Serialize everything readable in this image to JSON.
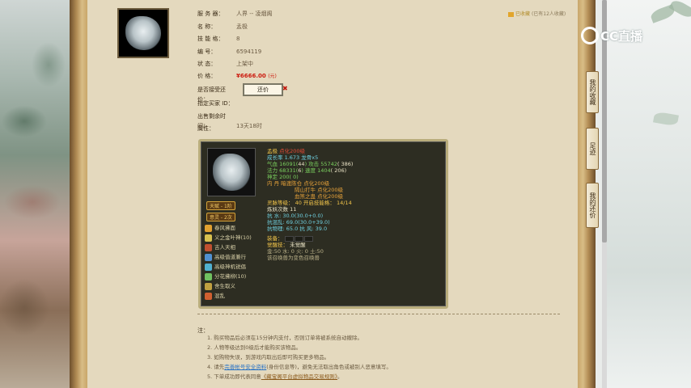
{
  "watermark": {
    "text": "CC直播"
  },
  "favorite": {
    "link": "已收藏",
    "count": "(已有12人收藏)"
  },
  "side_tabs": [
    "我的收藏",
    "足迹",
    "我的还价"
  ],
  "info_rows": [
    {
      "label": "服  务  器：",
      "value": "人界 -- 凌烟阁"
    },
    {
      "label": "名        称：",
      "value": "孟极"
    },
    {
      "label": "技  能  格：",
      "value": "8"
    },
    {
      "label": "编        号：",
      "value": "6594119"
    },
    {
      "label": "状        态：",
      "value": "上架中"
    },
    {
      "label": "价        格：",
      "value": "¥6666.00",
      "unit": "(元)"
    },
    {
      "label": "是否接受还价：",
      "value": ""
    },
    {
      "label": "指定买家 ID：",
      "value": ""
    },
    {
      "label": "出售剩余时间：",
      "value": "13天18时"
    },
    {
      "label": "属性：",
      "value": ""
    }
  ],
  "bargain_button": "还价",
  "bargain_reject": "✖",
  "card": {
    "pill_tianjue": "天赋 - 1阶",
    "pill_yili": "意灵 - 2次",
    "skills": [
      {
        "name": "春风拂面",
        "color": "#e0a030"
      },
      {
        "name": "义之金叶神(10)",
        "color": "#d7c050"
      },
      {
        "name": "吉人天相",
        "color": "#c05030"
      },
      {
        "name": "高级值道兼行",
        "color": "#5090d0"
      },
      {
        "name": "高级神机锐倡",
        "color": "#50b0d0"
      },
      {
        "name": "分花拂柳(10)",
        "color": "#70c060"
      },
      {
        "name": "舍生取义",
        "color": "#c0a040"
      },
      {
        "name": "混乱",
        "color": "#d06030"
      }
    ],
    "stats": {
      "name": "孟极",
      "name_tag": "点化200级",
      "growth": "成长率 1.673 龙骨x5",
      "hp": "气血 16091(",
      "hp_b": "44",
      "hp_c": ") 攻击 ",
      "atk": "55742",
      "atk_b": "( 386)",
      "mp": "法力 68331(",
      "mp_b": "6",
      "mp_c": ") 速度 ",
      "spd": "1404",
      "spd_b": "( 206)",
      "def": "神定 200( 0)",
      "inner_1": "内    丹  暗渡陈仓  点化200级",
      "inner_2": "隔山打牛  点化200级",
      "inner_3": "血煞之蛊  点化200级",
      "spirit": "灵脉等级：  40  开启技能格：  14/14",
      "refine": "炼妖次数 11",
      "res_water": "抗    水: 30.0(30.0+0.0)",
      "res_chaos": "抗混乱: 69.0(30.0+39.0)",
      "res_seal": "抗物理: 65.0  抗    风: 39.0",
      "equip": "装备：",
      "awaken_label": "觉醒技：",
      "awaken_value": "未觉醒",
      "elements": "金:50  水: 0  火: 0  土:50",
      "summon": "该召唤兽为变色召唤兽"
    }
  },
  "notes": {
    "title": "注：",
    "items": [
      "1. 购买物品后必须在15分钟内支付，否则订单将被系统自动撤除。",
      "2. 人物等级达到0级后才能购买该物品。",
      "3. 如购物失误，到游戏内取出后即可购买更多物品。",
      "4. 请先",
      "5. 下单成功即代表同意"
    ],
    "item4_link": "完善帐号安全资料",
    "item4_tail": "(身份信息等)，避免无法取出角色或被别人恶意填写。",
    "item5_link": "《藏宝阁平台虚拟物品交易规则》",
    "item5_tail": "。"
  }
}
